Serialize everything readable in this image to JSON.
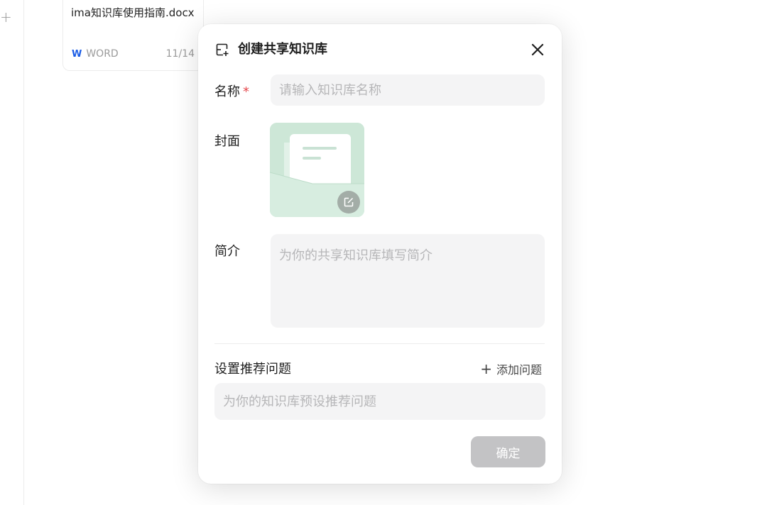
{
  "background": {
    "plus_symbol": "+",
    "file_card": {
      "name": "ima知识库使用指南.docx",
      "type_badge": "W",
      "type_label": "WORD",
      "date": "11/14"
    }
  },
  "dialog": {
    "title": "创建共享知识库",
    "name_label": "名称",
    "required_mark": "*",
    "name_placeholder": "请输入知识库名称",
    "cover_label": "封面",
    "intro_label": "简介",
    "intro_placeholder": "为你的共享知识库填写简介",
    "questions_title": "设置推荐问题",
    "add_question_icon": "+",
    "add_question_label": "添加问题",
    "question_placeholder": "为你的知识库预设推荐问题",
    "confirm_label": "确定"
  },
  "colors": {
    "required": "#e5484d",
    "input_bg": "#f4f4f5",
    "confirm_disabled_bg": "#c3c3c5",
    "cover_green": "#cfe8d9",
    "word_blue": "#1a5ce6"
  },
  "icons": [
    "create-library-icon",
    "close-icon",
    "cover-edit-icon",
    "plus-icon",
    "word-icon"
  ]
}
